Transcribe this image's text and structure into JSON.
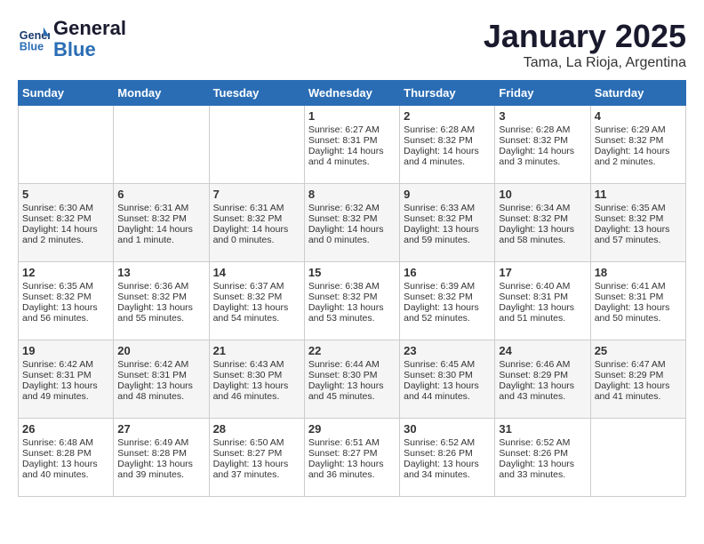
{
  "header": {
    "logo_line1": "General",
    "logo_line2": "Blue",
    "month": "January 2025",
    "location": "Tama, La Rioja, Argentina"
  },
  "weekdays": [
    "Sunday",
    "Monday",
    "Tuesday",
    "Wednesday",
    "Thursday",
    "Friday",
    "Saturday"
  ],
  "weeks": [
    [
      {
        "day": "",
        "info": ""
      },
      {
        "day": "",
        "info": ""
      },
      {
        "day": "",
        "info": ""
      },
      {
        "day": "1",
        "info": "Sunrise: 6:27 AM\nSunset: 8:31 PM\nDaylight: 14 hours\nand 4 minutes."
      },
      {
        "day": "2",
        "info": "Sunrise: 6:28 AM\nSunset: 8:32 PM\nDaylight: 14 hours\nand 4 minutes."
      },
      {
        "day": "3",
        "info": "Sunrise: 6:28 AM\nSunset: 8:32 PM\nDaylight: 14 hours\nand 3 minutes."
      },
      {
        "day": "4",
        "info": "Sunrise: 6:29 AM\nSunset: 8:32 PM\nDaylight: 14 hours\nand 2 minutes."
      }
    ],
    [
      {
        "day": "5",
        "info": "Sunrise: 6:30 AM\nSunset: 8:32 PM\nDaylight: 14 hours\nand 2 minutes."
      },
      {
        "day": "6",
        "info": "Sunrise: 6:31 AM\nSunset: 8:32 PM\nDaylight: 14 hours\nand 1 minute."
      },
      {
        "day": "7",
        "info": "Sunrise: 6:31 AM\nSunset: 8:32 PM\nDaylight: 14 hours\nand 0 minutes."
      },
      {
        "day": "8",
        "info": "Sunrise: 6:32 AM\nSunset: 8:32 PM\nDaylight: 14 hours\nand 0 minutes."
      },
      {
        "day": "9",
        "info": "Sunrise: 6:33 AM\nSunset: 8:32 PM\nDaylight: 13 hours\nand 59 minutes."
      },
      {
        "day": "10",
        "info": "Sunrise: 6:34 AM\nSunset: 8:32 PM\nDaylight: 13 hours\nand 58 minutes."
      },
      {
        "day": "11",
        "info": "Sunrise: 6:35 AM\nSunset: 8:32 PM\nDaylight: 13 hours\nand 57 minutes."
      }
    ],
    [
      {
        "day": "12",
        "info": "Sunrise: 6:35 AM\nSunset: 8:32 PM\nDaylight: 13 hours\nand 56 minutes."
      },
      {
        "day": "13",
        "info": "Sunrise: 6:36 AM\nSunset: 8:32 PM\nDaylight: 13 hours\nand 55 minutes."
      },
      {
        "day": "14",
        "info": "Sunrise: 6:37 AM\nSunset: 8:32 PM\nDaylight: 13 hours\nand 54 minutes."
      },
      {
        "day": "15",
        "info": "Sunrise: 6:38 AM\nSunset: 8:32 PM\nDaylight: 13 hours\nand 53 minutes."
      },
      {
        "day": "16",
        "info": "Sunrise: 6:39 AM\nSunset: 8:32 PM\nDaylight: 13 hours\nand 52 minutes."
      },
      {
        "day": "17",
        "info": "Sunrise: 6:40 AM\nSunset: 8:31 PM\nDaylight: 13 hours\nand 51 minutes."
      },
      {
        "day": "18",
        "info": "Sunrise: 6:41 AM\nSunset: 8:31 PM\nDaylight: 13 hours\nand 50 minutes."
      }
    ],
    [
      {
        "day": "19",
        "info": "Sunrise: 6:42 AM\nSunset: 8:31 PM\nDaylight: 13 hours\nand 49 minutes."
      },
      {
        "day": "20",
        "info": "Sunrise: 6:42 AM\nSunset: 8:31 PM\nDaylight: 13 hours\nand 48 minutes."
      },
      {
        "day": "21",
        "info": "Sunrise: 6:43 AM\nSunset: 8:30 PM\nDaylight: 13 hours\nand 46 minutes."
      },
      {
        "day": "22",
        "info": "Sunrise: 6:44 AM\nSunset: 8:30 PM\nDaylight: 13 hours\nand 45 minutes."
      },
      {
        "day": "23",
        "info": "Sunrise: 6:45 AM\nSunset: 8:30 PM\nDaylight: 13 hours\nand 44 minutes."
      },
      {
        "day": "24",
        "info": "Sunrise: 6:46 AM\nSunset: 8:29 PM\nDaylight: 13 hours\nand 43 minutes."
      },
      {
        "day": "25",
        "info": "Sunrise: 6:47 AM\nSunset: 8:29 PM\nDaylight: 13 hours\nand 41 minutes."
      }
    ],
    [
      {
        "day": "26",
        "info": "Sunrise: 6:48 AM\nSunset: 8:28 PM\nDaylight: 13 hours\nand 40 minutes."
      },
      {
        "day": "27",
        "info": "Sunrise: 6:49 AM\nSunset: 8:28 PM\nDaylight: 13 hours\nand 39 minutes."
      },
      {
        "day": "28",
        "info": "Sunrise: 6:50 AM\nSunset: 8:27 PM\nDaylight: 13 hours\nand 37 minutes."
      },
      {
        "day": "29",
        "info": "Sunrise: 6:51 AM\nSunset: 8:27 PM\nDaylight: 13 hours\nand 36 minutes."
      },
      {
        "day": "30",
        "info": "Sunrise: 6:52 AM\nSunset: 8:26 PM\nDaylight: 13 hours\nand 34 minutes."
      },
      {
        "day": "31",
        "info": "Sunrise: 6:52 AM\nSunset: 8:26 PM\nDaylight: 13 hours\nand 33 minutes."
      },
      {
        "day": "",
        "info": ""
      }
    ]
  ]
}
